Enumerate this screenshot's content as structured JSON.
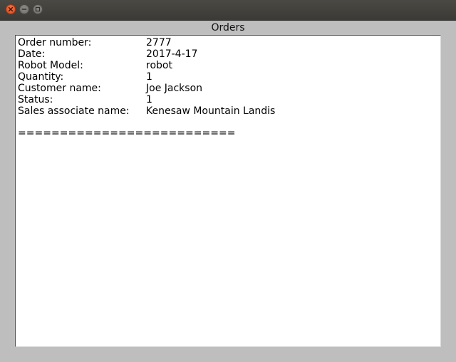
{
  "window": {
    "title": "Orders"
  },
  "order": {
    "fields": [
      {
        "label": "Order number:",
        "value": "2777"
      },
      {
        "label": "Date:",
        "value": "2017-4-17"
      },
      {
        "label": "Robot Model:",
        "value": "robot"
      },
      {
        "label": "Quantity:",
        "value": "1"
      },
      {
        "label": "Customer name:",
        "value": "Joe Jackson"
      },
      {
        "label": "Status:",
        "value": "1"
      },
      {
        "label": "Sales associate name:",
        "value": "Kenesaw Mountain Landis"
      }
    ],
    "separator": "=========================="
  },
  "icons": {
    "close": "close-icon",
    "minimize": "minimize-icon",
    "maximize": "maximize-icon"
  },
  "colors": {
    "close_button": "#dd4814",
    "titlebar": "#3b3a36",
    "window_bg": "#bebebe"
  }
}
